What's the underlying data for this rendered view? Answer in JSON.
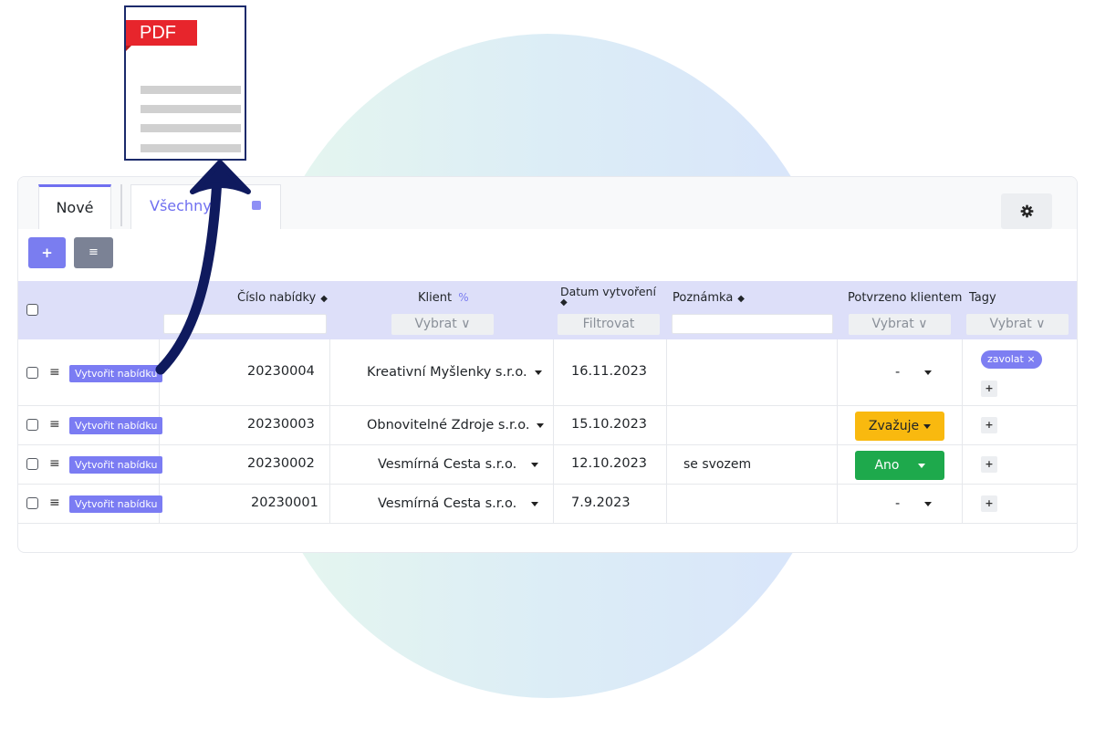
{
  "pdf_icon": {
    "label": "PDF"
  },
  "tabs": [
    {
      "label": "Nové",
      "active": true
    },
    {
      "label": "Všechny",
      "active": false
    }
  ],
  "toolbar": {
    "add_label": "+",
    "list_label": "≡"
  },
  "table": {
    "headers": {
      "cislo": "Číslo nabídky",
      "klient": "Klient",
      "datum": "Datum vytvoření",
      "poznamka": "Poznámka",
      "potvrzeno": "Potvrzeno klientem",
      "tagy": "Tagy"
    },
    "filters": {
      "klient": "Vybrat ∨",
      "datum": "Filtrovat",
      "potvrzeno": "Vybrat ∨",
      "tagy": "Vybrat ∨"
    },
    "create_label": "Vytvořit nabídku",
    "rows": [
      {
        "number": "20230004",
        "client": "Kreativní Myšlenky s.r.o.",
        "date": "16.11.2023",
        "note": "",
        "status": "-",
        "tags": [
          "zavolat ×"
        ]
      },
      {
        "number": "20230003",
        "client": "Obnovitelné Zdroje s.r.o.",
        "date": "15.10.2023",
        "note": "",
        "status": "Zvažuje",
        "tags": []
      },
      {
        "number": "20230002",
        "client": "Vesmírná Cesta s.r.o.",
        "date": "12.10.2023",
        "note": "se svozem",
        "status": "Ano",
        "tags": []
      },
      {
        "number": "20230001",
        "client": "Vesmírná Cesta s.r.o.",
        "date": "7.9.2023",
        "note": "",
        "status": "-",
        "tags": []
      }
    ],
    "plus_label": "+"
  },
  "colors": {
    "accent": "#7b7cf3",
    "pdf_red": "#e7252c",
    "status_zvazuje": "#f9b90f",
    "status_ano": "#1ea94c",
    "arrow_navy": "#0f1a5e"
  }
}
